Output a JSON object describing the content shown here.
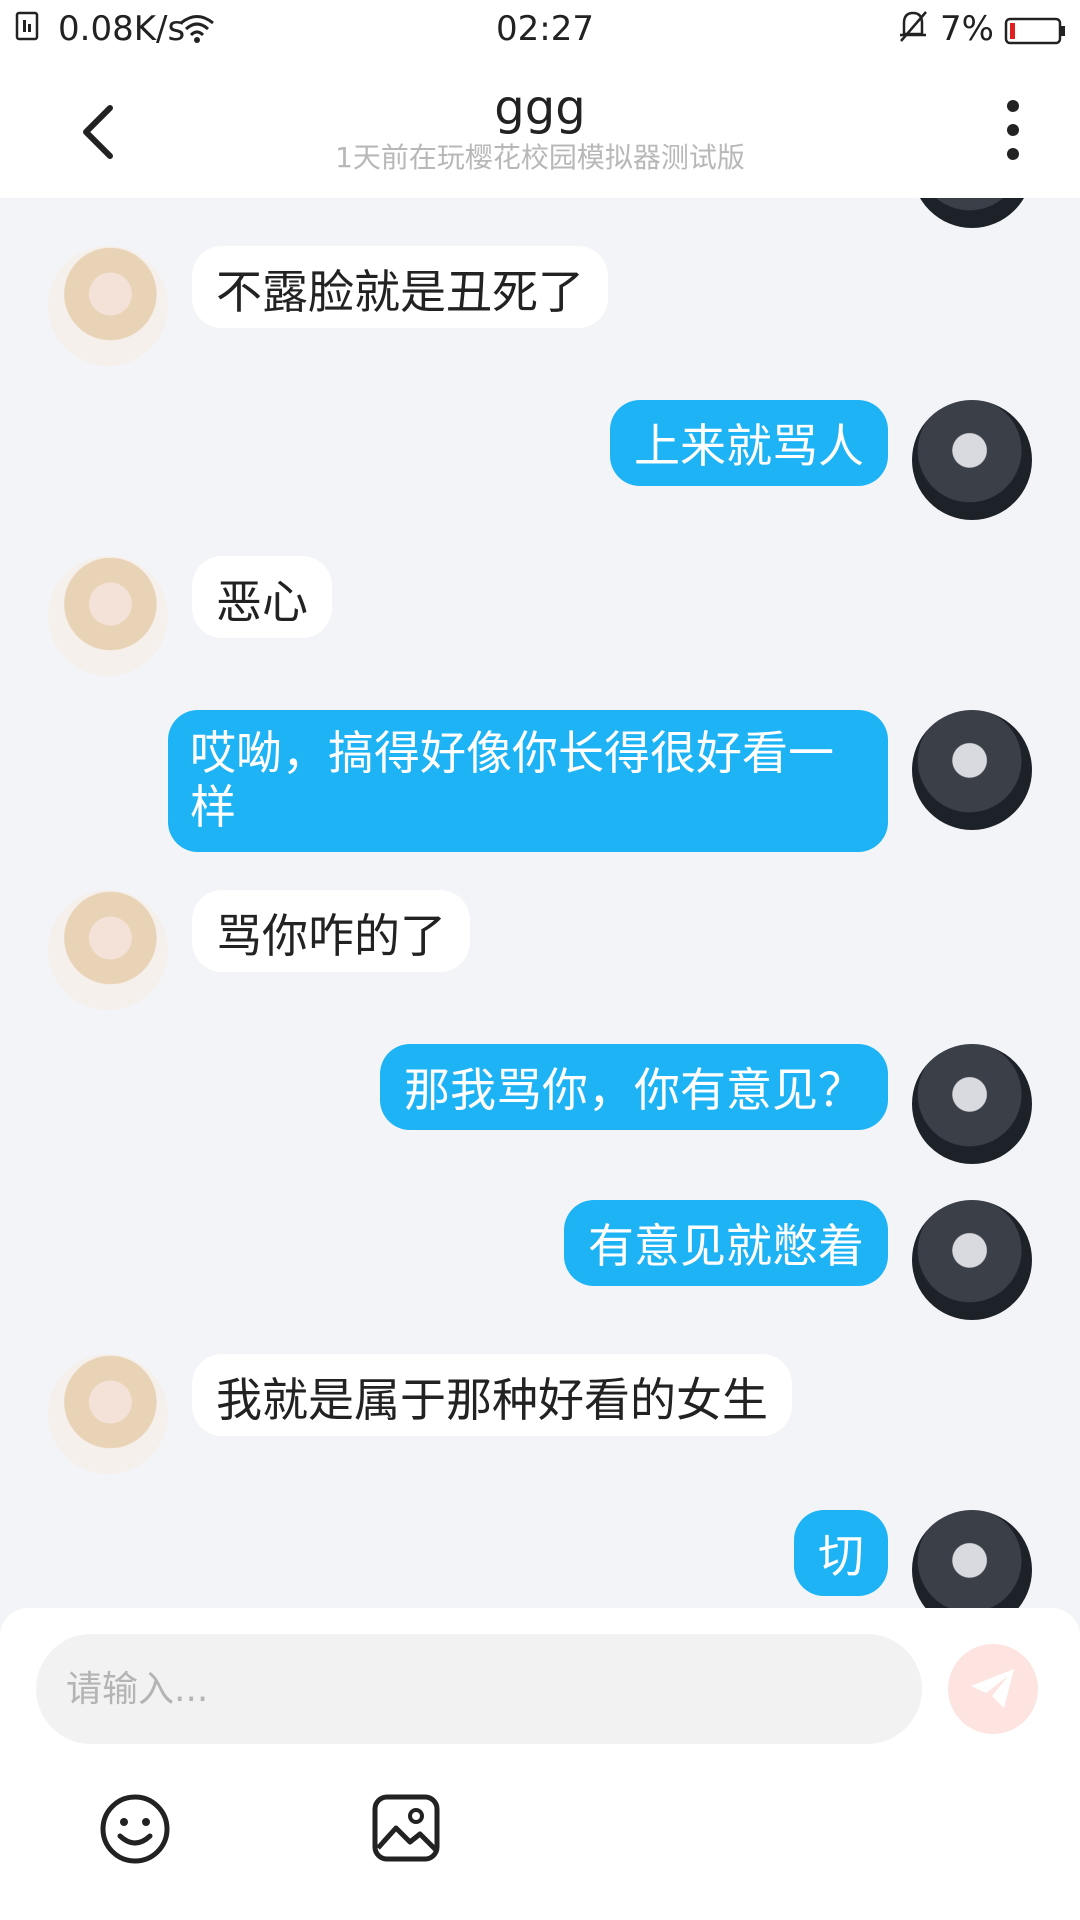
{
  "status_bar": {
    "net_speed": "0.08K/s",
    "time": "02:27",
    "battery": "7%"
  },
  "header": {
    "title": "ggg",
    "subtitle": "1天前在玩樱花校园模拟器测试版"
  },
  "messages": [
    {
      "side": "in",
      "text": "不露脸就是丑死了"
    },
    {
      "side": "out",
      "text": "上来就骂人"
    },
    {
      "side": "in",
      "text": "恶心"
    },
    {
      "side": "out",
      "text": "哎呦，搞得好像你长得很好看一样"
    },
    {
      "side": "in",
      "text": "骂你咋的了"
    },
    {
      "side": "out",
      "text": "那我骂你，你有意见？"
    },
    {
      "side": "out",
      "text": "有意见就憋着"
    },
    {
      "side": "in",
      "text": "我就是属于那种好看的女生"
    },
    {
      "side": "out",
      "text": "切"
    }
  ],
  "input": {
    "placeholder": "请输入..."
  },
  "icons": {
    "back": "back-arrow-icon",
    "more": "more-vertical-icon",
    "send": "send-plane-icon",
    "emoji": "emoji-icon",
    "image": "image-icon"
  },
  "colors": {
    "outgoing_bubble": "#1eb3f5",
    "incoming_bubble": "#ffffff",
    "chat_background": "#f2f4f7",
    "send_button": "#fde4e0",
    "battery_low": "#e02020"
  }
}
